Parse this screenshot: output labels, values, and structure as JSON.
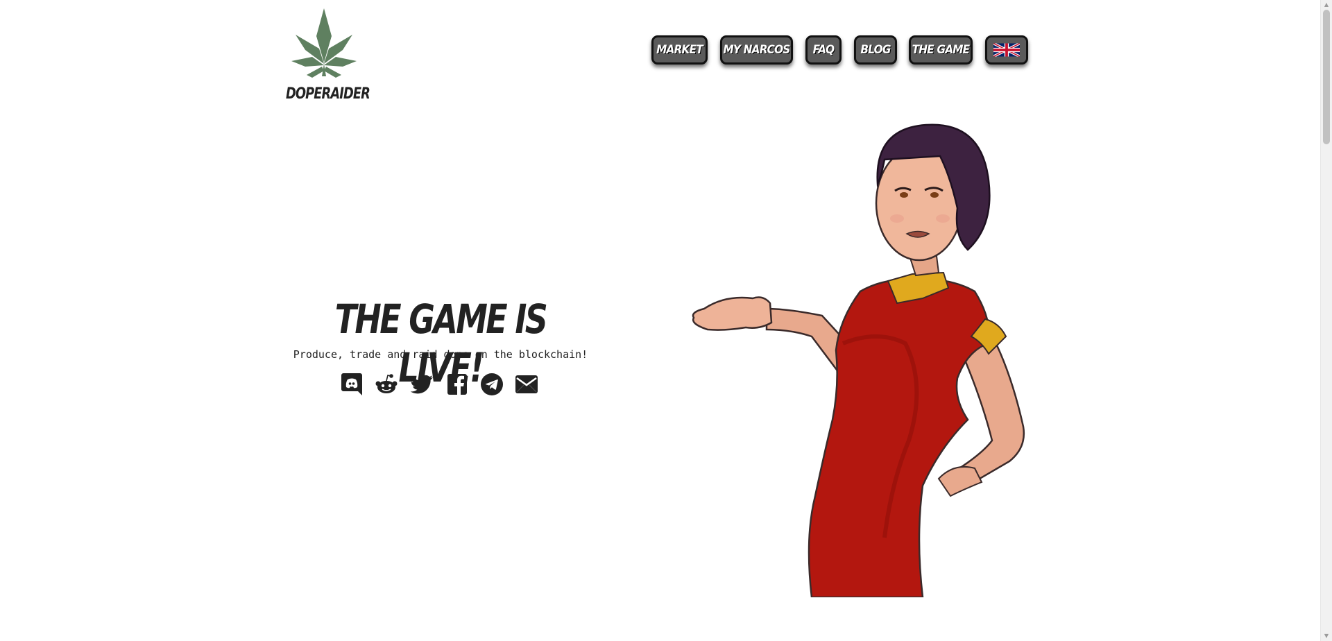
{
  "brand": {
    "name": "DOPERAIDER",
    "logo_color": "#5f8060"
  },
  "nav": {
    "items": [
      {
        "label": "MARKET"
      },
      {
        "label": "MY NARCOS"
      },
      {
        "label": "FAQ"
      },
      {
        "label": "BLOG"
      },
      {
        "label": "THE GAME"
      }
    ],
    "language": {
      "icon": "uk-flag-icon"
    },
    "button_color": "#5a5a5a"
  },
  "hero": {
    "title": "THE GAME IS LIVE!",
    "subtitle": "Produce, trade and raid dope on the blockchain!",
    "socials": [
      {
        "icon": "discord-icon"
      },
      {
        "icon": "reddit-icon"
      },
      {
        "icon": "twitter-icon"
      },
      {
        "icon": "facebook-icon"
      },
      {
        "icon": "telegram-icon"
      },
      {
        "icon": "email-icon"
      }
    ]
  },
  "character": {
    "dress_color": "#b3170f",
    "accent_color": "#e0a91e"
  }
}
